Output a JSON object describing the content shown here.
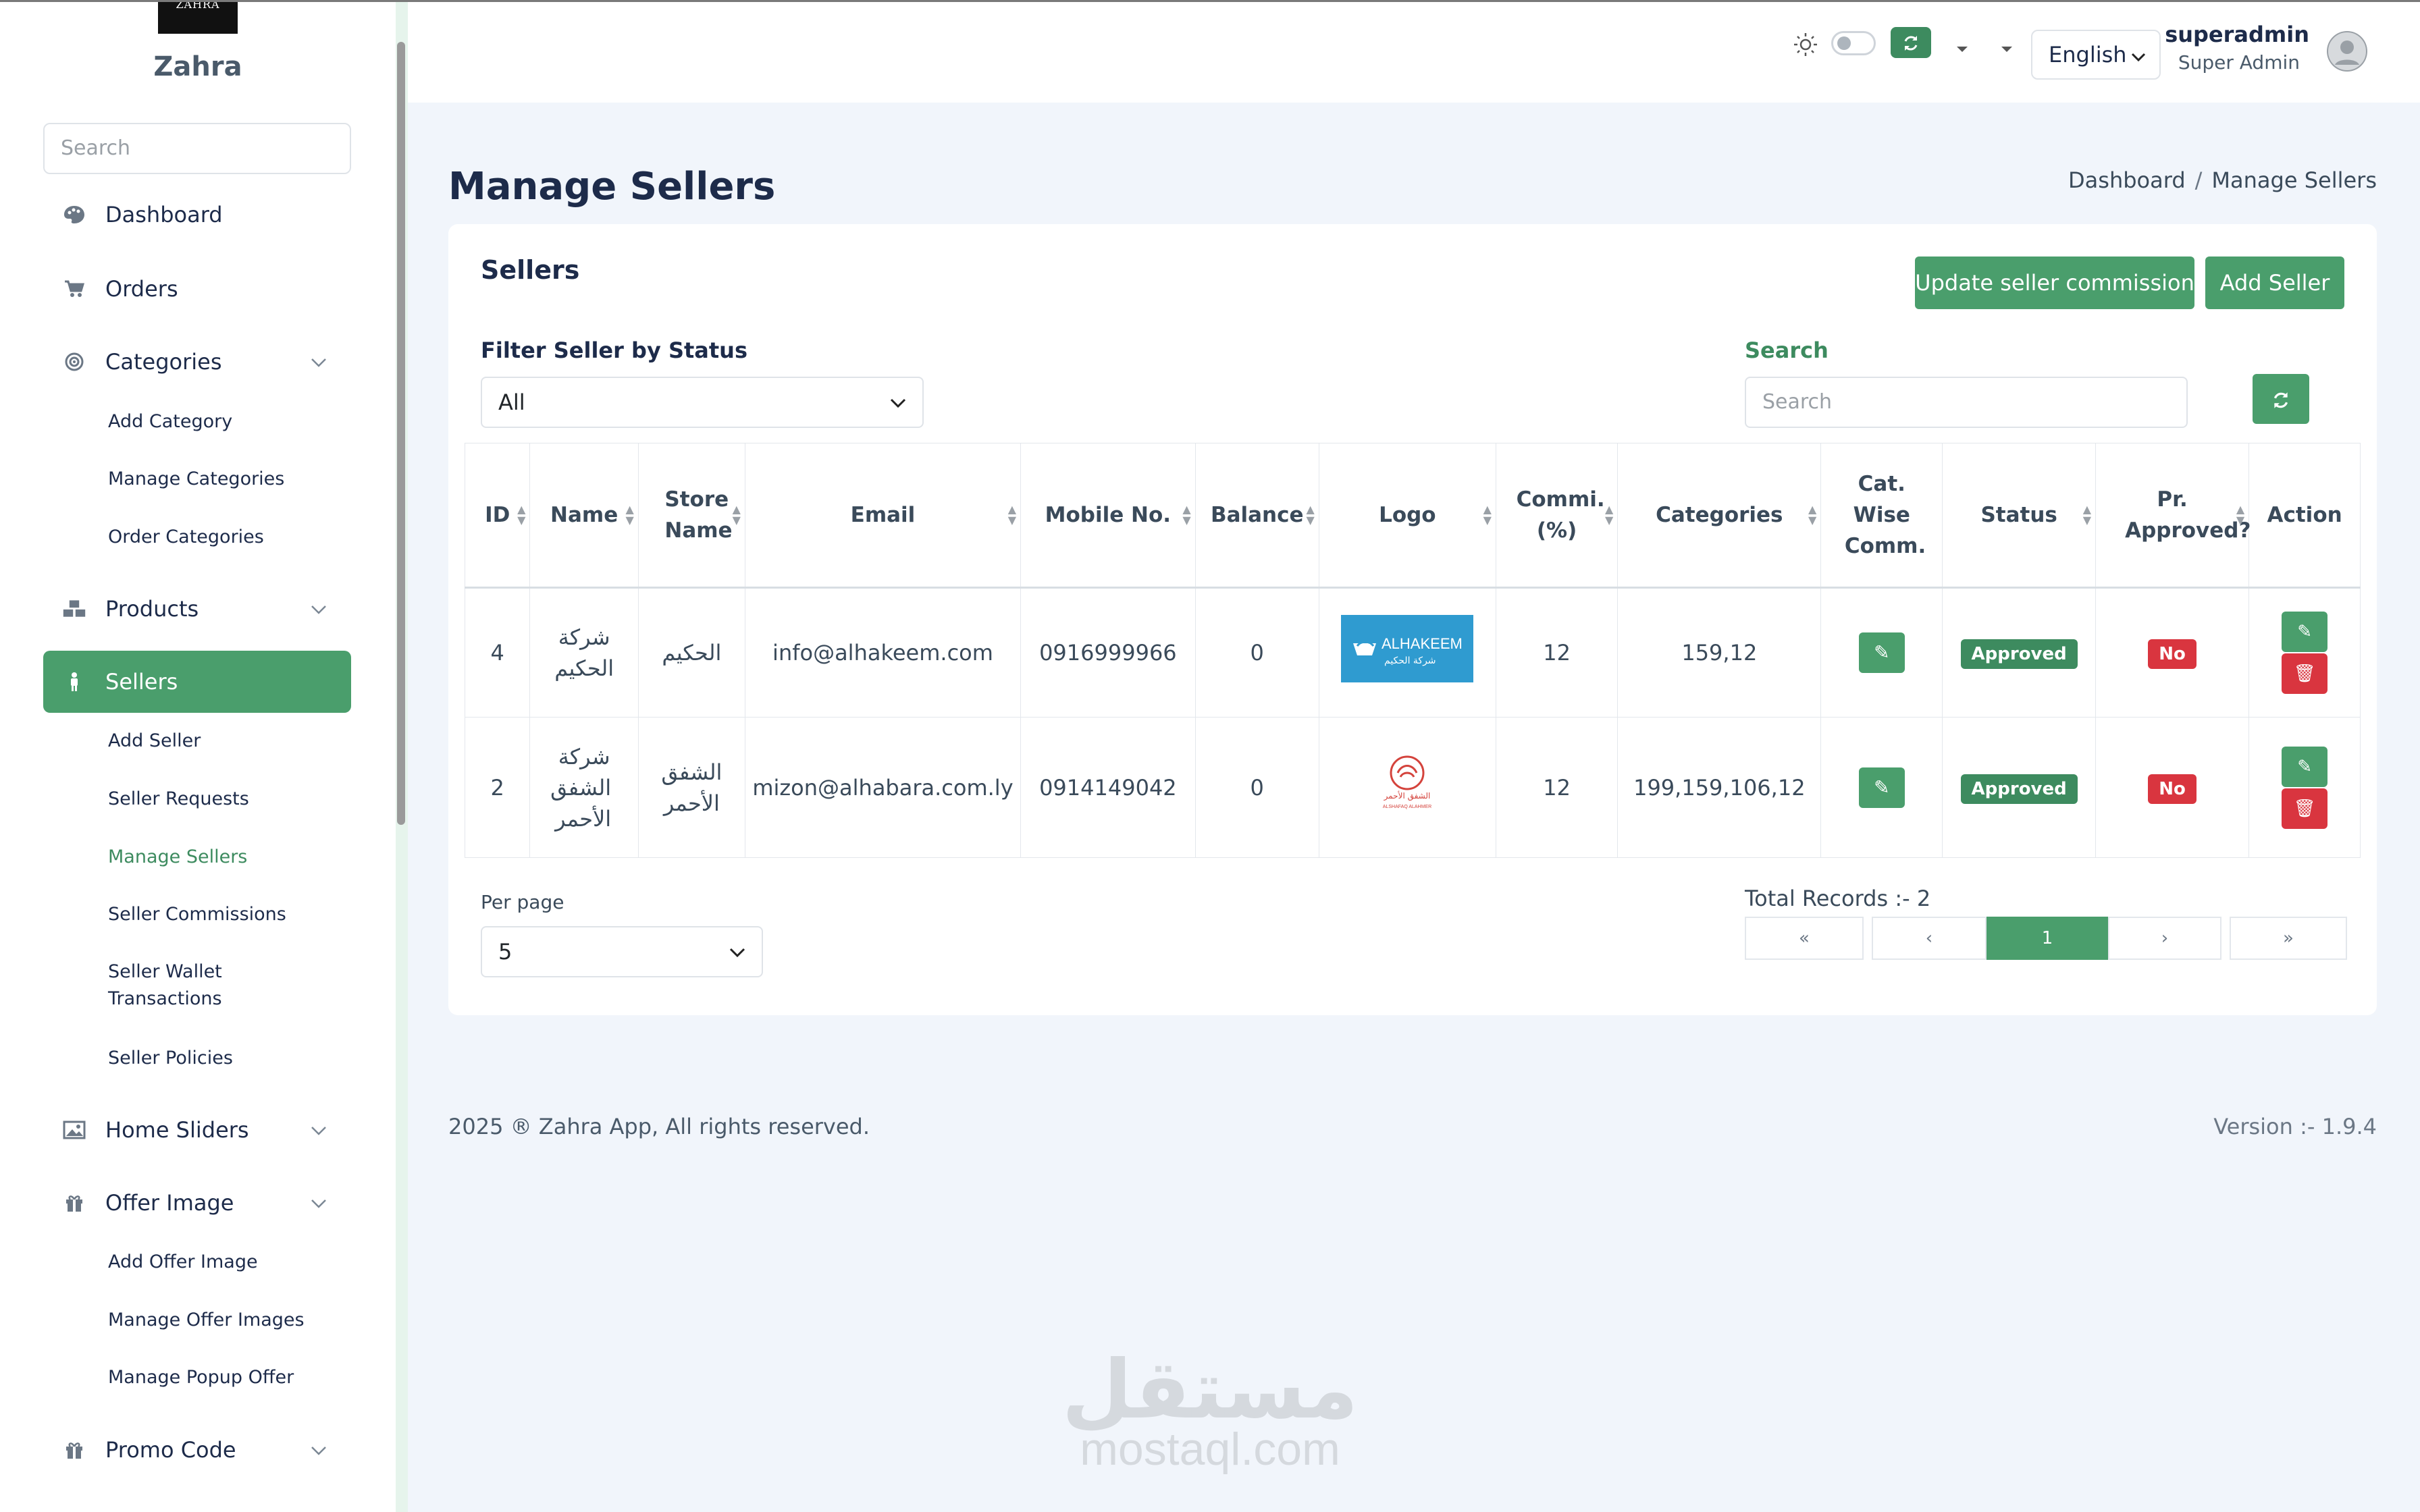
{
  "app": {
    "logo_text": "ZAHRA",
    "brand": "Zahra"
  },
  "sidebar": {
    "search_placeholder": "Search",
    "items": [
      {
        "label": "Dashboard",
        "icon": "palette-icon"
      },
      {
        "label": "Orders",
        "icon": "cart-icon"
      },
      {
        "label": "Categories",
        "icon": "target-icon",
        "expandable": true
      },
      {
        "label": "Products",
        "icon": "cubes-icon",
        "expandable": true
      },
      {
        "label": "Sellers",
        "icon": "person-icon",
        "active": true
      },
      {
        "label": "Home Sliders",
        "icon": "image-icon",
        "expandable": true
      },
      {
        "label": "Offer Image",
        "icon": "gift-icon",
        "expandable": true
      },
      {
        "label": "Promo Code",
        "icon": "gift-icon",
        "expandable": true
      }
    ],
    "categories_sub": [
      "Add Category",
      "Manage Categories",
      "Order Categories"
    ],
    "sellers_sub": [
      "Add Seller",
      "Seller Requests",
      "Manage Sellers",
      "Seller Commissions",
      "Seller Wallet",
      "Transactions",
      "Seller Policies"
    ],
    "offer_sub": [
      "Add Offer Image",
      "Manage Offer Images",
      "Manage Popup Offer"
    ]
  },
  "topbar": {
    "language": "English",
    "user_name": "superadmin",
    "user_role": "Super Admin"
  },
  "page": {
    "title": "Manage Sellers",
    "breadcrumb": [
      "Dashboard",
      "Manage Sellers"
    ]
  },
  "card": {
    "title": "Sellers",
    "update_commission_label": "Update seller commission",
    "add_seller_label": "Add Seller",
    "filter_label": "Filter Seller by Status",
    "filter_value": "All",
    "search_label": "Search",
    "search_placeholder": "Search",
    "per_page_label": "Per page",
    "per_page_value": "5",
    "total_records": "Total Records :- 2",
    "pager": [
      "«",
      "‹",
      "1",
      "›",
      "»"
    ]
  },
  "table": {
    "headers": [
      "ID",
      "Name",
      "Store Name",
      "Email",
      "Mobile No.",
      "Balance",
      "Logo",
      "Commi. (%)",
      "Categories",
      "Cat. Wise Comm.",
      "Status",
      "Pr. Approved?",
      "Action"
    ],
    "rows": [
      {
        "id": "4",
        "name": "شركة الحكيم",
        "store": "الحكيم",
        "email": "info@alhakeem.com",
        "mobile": "0916999966",
        "balance": "0",
        "logo_text": "ALHAKEEM",
        "logo_sub": "شركة الحكيم",
        "commission": "12",
        "categories": "159,12",
        "status": "Approved",
        "approved": "No"
      },
      {
        "id": "2",
        "name": "شركة الشفق الأحمر",
        "store": "الشفق الأحمر",
        "email": "mizon@alhabara.com.ly",
        "mobile": "0914149042",
        "balance": "0",
        "logo_text": "الشفق الأحمر",
        "logo_sub": "ALSHAFAQ ALAHMER",
        "commission": "12",
        "categories": "199,159,106,12",
        "status": "Approved",
        "approved": "No"
      }
    ]
  },
  "footer": {
    "copyright": "2025 ® Zahra App, All rights reserved.",
    "version": "Version :- 1.9.4"
  },
  "watermark": {
    "arabic": "مستقل",
    "latin": "mostaql.com"
  },
  "colors": {
    "accent": "#4a9e6c",
    "danger": "#d9353f",
    "background": "#f1f5fb"
  }
}
